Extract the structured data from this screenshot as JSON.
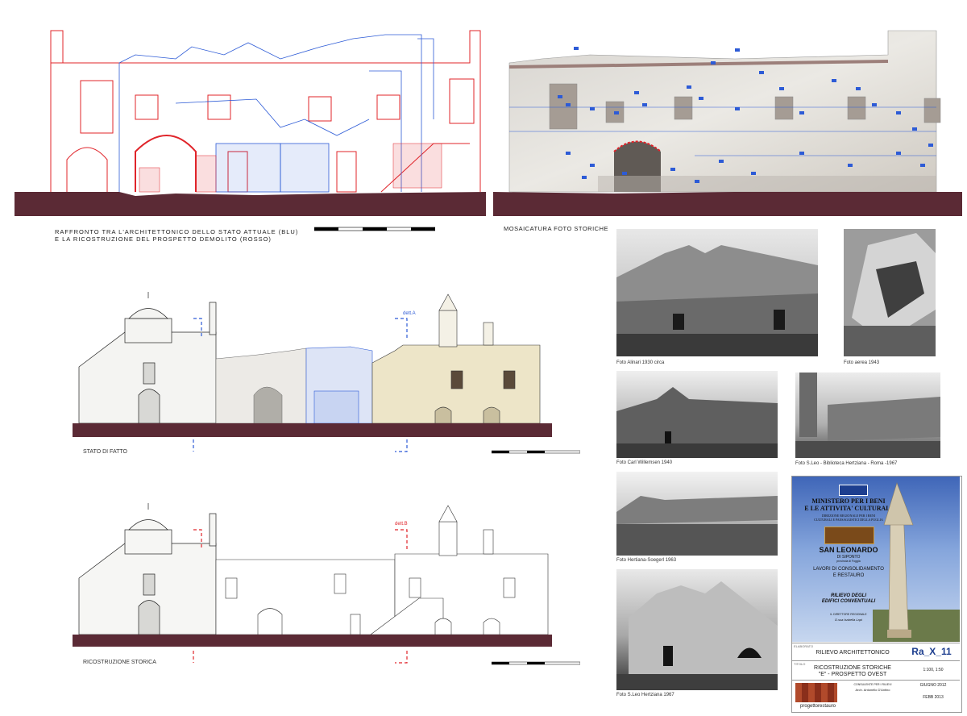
{
  "top_left": {
    "caption_line1": "RAFFRONTO TRA L'ARCHITETTONICO DELLO STATO ATTUALE (BLU)",
    "caption_line2": "E LA RICOSTRUZIONE DEL PROSPETTO DEMOLITO (ROSSO)"
  },
  "top_right": {
    "caption": "MOSAICATURA FOTO STORICHE"
  },
  "middle": {
    "caption": "STATO DI FATTO",
    "detail_tag": "dett.A"
  },
  "bottom": {
    "caption": "RICOSTRUZIONE STORICA",
    "detail_tag": "dett.B"
  },
  "photos": [
    {
      "caption": "Foto Alinari 1930 circa"
    },
    {
      "caption": "Foto aerea 1943"
    },
    {
      "caption": "Foto Carl Willemsen 1940"
    },
    {
      "caption": "Foto S.Leo - Biblioteca Hertziana - Roma -1967"
    },
    {
      "caption": "Foto Hertiana-Soegerl 1963"
    },
    {
      "caption": "Foto S.Leo Hertziana 1967"
    }
  ],
  "title_block": {
    "ministry_line1": "MINISTERO PER I BENI",
    "ministry_line2": "E LE ATTIVITA' CULTURALI",
    "direction_line1": "DIREZIONE REGIONALE PER I BENI",
    "direction_line2": "CULTURALI E PAESAGGISTICI DELLA PUGLIA",
    "site_name": "SAN LEONARDO",
    "site_sub": "DI SIPONTO",
    "site_province": "provincia di Foggia",
    "works_line1": "LAVORI DI CONSOLIDAMENTO",
    "works_line2": "E RESTAURO",
    "survey_line1": "RILIEVO DEGLI",
    "survey_line2": "EDIFICI CONVENTUALI",
    "director_label": "IL DIRETTORE REGIONALE",
    "director_name": "D.ssa Isabella Lapi",
    "sheet_code": "Ra_X_11",
    "scale": "1:100, 1:50",
    "row1_label": "ELABORATO",
    "row1_value": "RILIEVO ARCHITETTONICO",
    "row2_label": "TITOLO",
    "row2_value_line1": "RICOSTRUZIONE STORICHE",
    "row2_value_line2": "\"E\" - PROSPETTO OVEST",
    "date1": "GIUGNO 2012",
    "date2": "FEBB 2013",
    "consultant_label": "CONSULENTE PER I RILIEVI",
    "consultant_name": "Arch. Antonello D'Antino",
    "firm": "progettorestauro"
  },
  "colors": {
    "ground": "#5b2a35",
    "survey_blue": "#2d5bd6",
    "reconstruction_red": "#e0242a",
    "title_blue": "#3f66b8"
  }
}
